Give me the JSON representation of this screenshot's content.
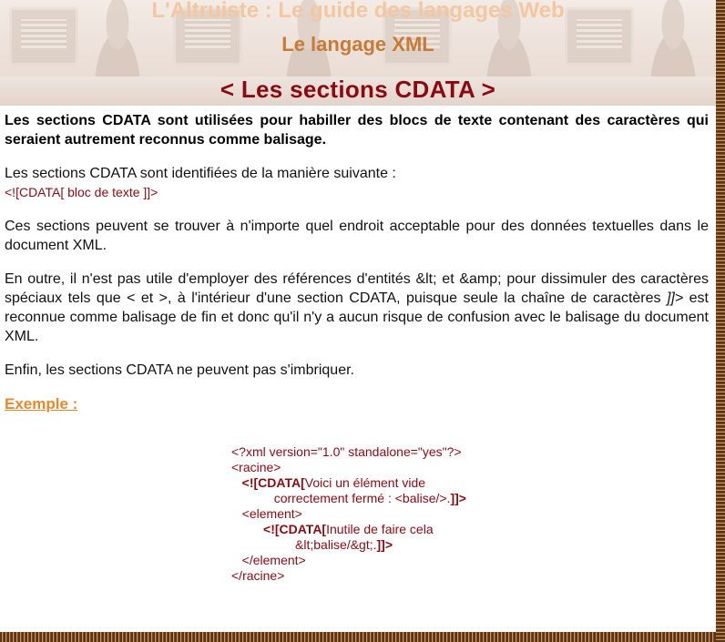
{
  "header": {
    "site_title": "L'Altruiste : Le guide des langages Web",
    "subtitle": "Le langage XML",
    "page_title": "< Les sections CDATA >"
  },
  "content": {
    "intro": "Les sections CDATA sont utilisées pour habiller des blocs de texte contenant des caractères qui seraient autrement reconnus comme balisage.",
    "para1": "Les sections CDATA sont identifiées de la manière suivante :",
    "syntax": "<![CDATA[ bloc de texte ]]>",
    "para2": "Ces sections peuvent se trouver à n'importe quel endroit acceptable pour des données textuelles dans le document XML.",
    "para3_part1": "En outre, il n'est pas utile d'employer des références d'entités &lt; et &amp; pour dissimuler des caractères spéciaux tels que < et >, à l'intérieur d'une section CDATA, puisque seule la chaîne de caractères ",
    "para3_kw": "]]>",
    "para3_part2": " est reconnue comme balisage de fin et donc qu'il n'y a aucun risque de confusion avec le balisage du document XML.",
    "para4": "Enfin, les sections CDATA ne peuvent pas s'imbriquer.",
    "example_heading": "Exemple :"
  },
  "code": {
    "line1": "<?xml version=\"1.0\" standalone=\"yes\"?>",
    "line2": "<racine>",
    "line3_open": "<![CDATA[",
    "line3_text": "Voici un élément vide",
    "line4_text": "correctement fermé : <balise/>.",
    "line4_close": "]]>",
    "line5": "<element>",
    "line6_open": "<![CDATA[",
    "line6_text": "Inutile de faire cela",
    "line7_text": "&lt;balise/&gt;.",
    "line7_close": "]]>",
    "line8": "</element>",
    "line9": "</racine>"
  },
  "colors": {
    "title_dark_red": "#8b0a12",
    "subtitle_orange": "#c87a37",
    "example_orange": "#e8882a",
    "border_brown": "#5a3416"
  }
}
